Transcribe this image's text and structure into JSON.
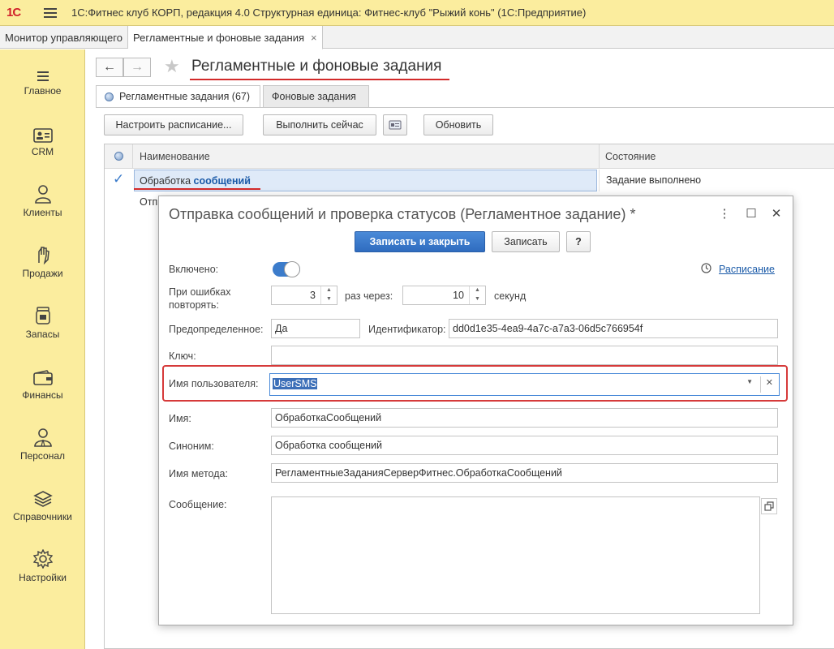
{
  "titlebar": {
    "logo": "1С",
    "title": "1С:Фитнес клуб КОРП, редакция 4.0 Структурная единица: Фитнес-клуб \"Рыжий конь\"  (1С:Предприятие)"
  },
  "tabs": [
    {
      "label": "Монитор управляющего"
    },
    {
      "label": "Регламентные и фоновые задания",
      "close": "×"
    }
  ],
  "sidebar": {
    "items": [
      {
        "label": "Главное",
        "icon": "menu-icon"
      },
      {
        "label": "CRM",
        "icon": "id-card-icon"
      },
      {
        "label": "Клиенты",
        "icon": "person-icon"
      },
      {
        "label": "Продажи",
        "icon": "hand-icon"
      },
      {
        "label": "Запасы",
        "icon": "jar-icon"
      },
      {
        "label": "Финансы",
        "icon": "wallet-icon"
      },
      {
        "label": "Персонал",
        "icon": "staff-icon"
      },
      {
        "label": "Справочники",
        "icon": "layers-icon"
      },
      {
        "label": "Настройки",
        "icon": "gear-icon"
      }
    ]
  },
  "page": {
    "back": "←",
    "forward": "→",
    "star": "★",
    "title": "Регламентные и фоновые задания",
    "subtabs": [
      "Регламентные задания (67)",
      "Фоновые задания"
    ],
    "buttons": {
      "schedule": "Настроить расписание...",
      "run_now": "Выполнить сейчас",
      "refresh": "Обновить"
    },
    "grid": {
      "columns": [
        "Наименование",
        "Состояние"
      ],
      "rows": [
        {
          "check": "✓",
          "name_plain": "Обработка ",
          "name_highlight": "сообщений",
          "state": "Задание выполнено"
        },
        {
          "check": "",
          "name_plain": "Отпр",
          "name_highlight": "",
          "state": ""
        }
      ]
    }
  },
  "dialog": {
    "title": "Отправка сообщений и проверка статусов (Регламентное задание) *",
    "controls": {
      "more": "⋮",
      "maximize": "☐",
      "close": "✕"
    },
    "buttons": {
      "save_close": "Записать и закрыть",
      "save": "Записать",
      "help": "?"
    },
    "enabled_label": "Включено:",
    "enabled": true,
    "schedule_link": "Расписание",
    "retry_label_1": "При ошибках",
    "retry_label_2": "повторять:",
    "retry_count": "3",
    "times_label": "раз  через:",
    "retry_interval": "10",
    "seconds_label": "секунд",
    "predefined_label": "Предопределенное:",
    "predefined_value": "Да",
    "id_label": "Идентификатор:",
    "id_value": "dd0d1e35-4ea9-4a7c-a7a3-06d5c766954f",
    "key_label": "Ключ:",
    "key_value": "",
    "username_label": "Имя пользователя:",
    "username_value": "UserSMS",
    "name_label": "Имя:",
    "name_value": "ОбработкаСообщений",
    "synonym_label": "Синоним:",
    "synonym_value": "Обработка сообщений",
    "method_label": "Имя метода:",
    "method_value": "РегламентныеЗаданияСерверФитнес.ОбработкаСообщений",
    "message_label": "Сообщение:",
    "message_value": ""
  }
}
